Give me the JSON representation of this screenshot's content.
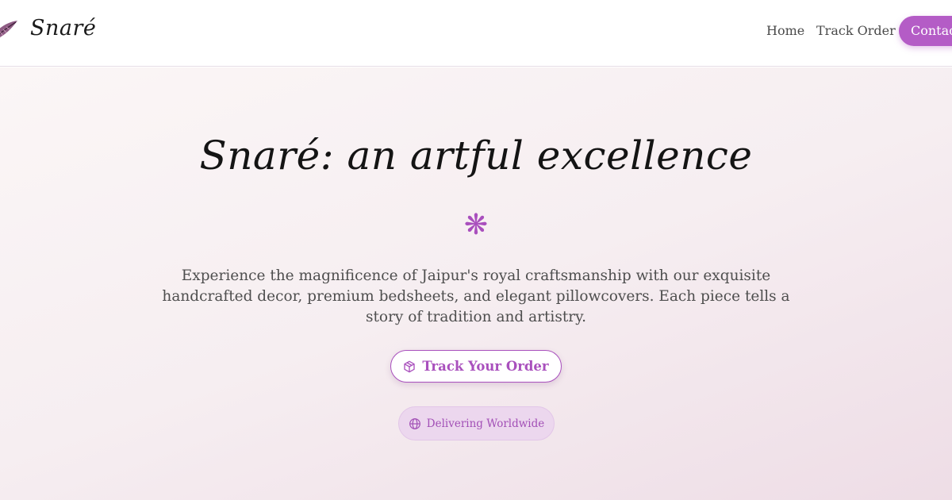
{
  "header": {
    "brand": "Snaré",
    "logo_icon": "feather-logo-icon",
    "nav": {
      "home": "Home",
      "track_order": "Track Order",
      "contact": "Contact"
    }
  },
  "hero": {
    "title": "Snaré: an artful excellence",
    "ornament": "❋",
    "description": "Experience the magnificence of Jaipur's royal craftsmanship with our exquisite handcrafted decor, premium bedsheets, and elegant pillowcovers. Each piece tells a story of tradition and artistry.",
    "track_button": {
      "label": "Track Your Order",
      "icon": "package-icon"
    },
    "badge": {
      "label": "Delivering Worldwide",
      "icon": "globe-icon"
    }
  },
  "colors": {
    "accent": "#b45cc6",
    "accent_text": "#a950bd",
    "badge_bg": "#ecd7ee"
  }
}
